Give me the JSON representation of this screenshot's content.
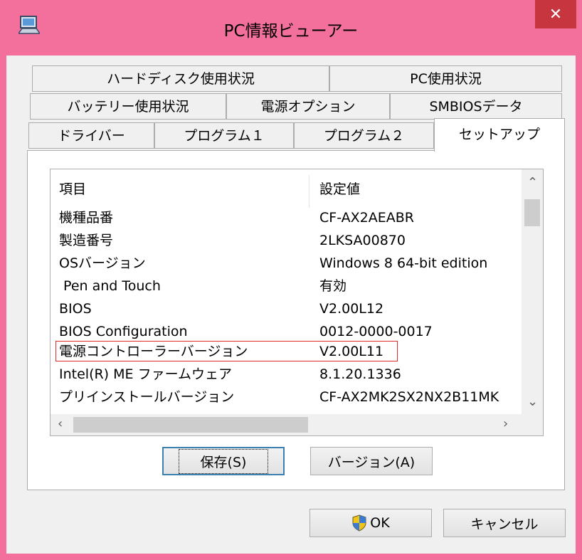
{
  "window": {
    "title": "PC情報ビューアー"
  },
  "tabs": {
    "row1": [
      "ハードディスク使用状況",
      "PC使用状況"
    ],
    "row2": [
      "バッテリー使用状況",
      "電源オプション",
      "SMBIOSデータ"
    ],
    "row3": [
      "ドライバー",
      "プログラム１",
      "プログラム２",
      "セットアップ"
    ],
    "active": "セットアップ"
  },
  "list": {
    "headers": [
      "項目",
      "設定値"
    ],
    "rows": [
      [
        "機種品番",
        "CF-AX2AEABR"
      ],
      [
        "製造番号",
        "2LKSA00870"
      ],
      [
        "OSバージョン",
        "Windows 8 64-bit edition"
      ],
      [
        " Pen and Touch",
        "有効"
      ],
      [
        "BIOS",
        "V2.00L12"
      ],
      [
        "BIOS Configuration",
        "0012-0000-0017"
      ],
      [
        "電源コントローラーバージョン",
        "V2.00L11"
      ],
      [
        "Intel(R) ME ファームウェア",
        "8.1.20.1336"
      ],
      [
        "プリインストールバージョン",
        "CF-AX2MK2SX2NX2B11MK"
      ]
    ]
  },
  "buttons": {
    "save": "保存(S)",
    "version": "バージョン(A)",
    "ok": "OK",
    "cancel": "キャンセル"
  },
  "colors": {
    "frame": "#f4709c",
    "close": "#c7353f",
    "highlight": "#e02a2a"
  },
  "icons": [
    "app-icon",
    "close-icon",
    "scroll-up-icon",
    "scroll-down-icon",
    "scroll-left-icon",
    "scroll-right-icon",
    "uac-shield-icon"
  ]
}
